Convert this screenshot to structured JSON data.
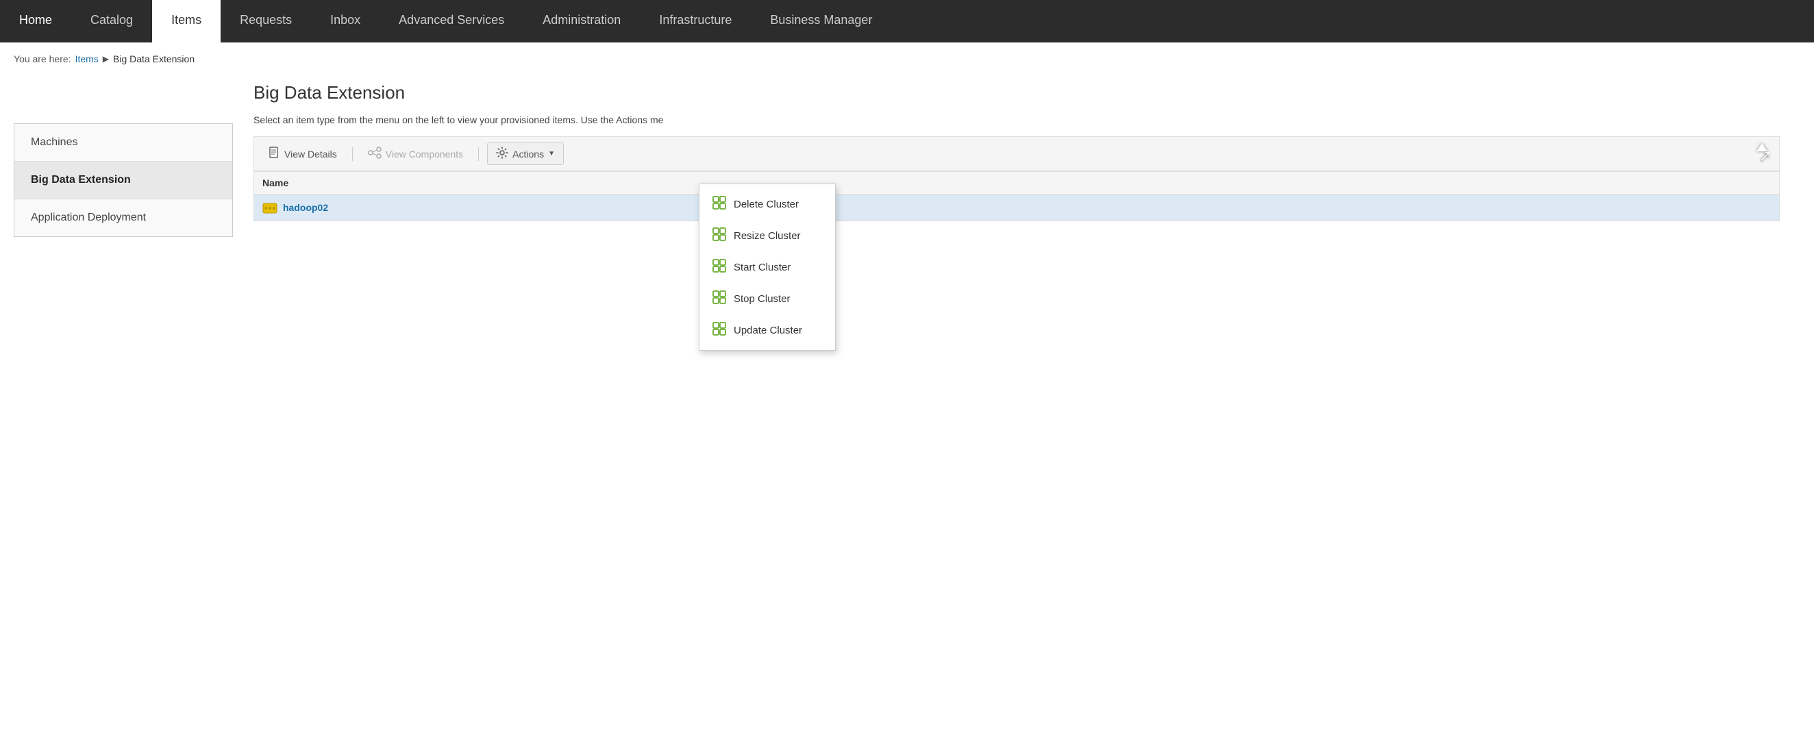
{
  "nav": {
    "items": [
      {
        "label": "Home",
        "active": false
      },
      {
        "label": "Catalog",
        "active": false
      },
      {
        "label": "Items",
        "active": true
      },
      {
        "label": "Requests",
        "active": false
      },
      {
        "label": "Inbox",
        "active": false
      },
      {
        "label": "Advanced Services",
        "active": false
      },
      {
        "label": "Administration",
        "active": false
      },
      {
        "label": "Infrastructure",
        "active": false
      },
      {
        "label": "Business Manager",
        "active": false
      }
    ]
  },
  "breadcrumb": {
    "prefix": "You are here:",
    "link": "Items",
    "separator": "▶",
    "current": "Big Data Extension"
  },
  "page": {
    "title": "Big Data Extension",
    "description": "Select an item type from the menu on the left to view your provisioned items. Use the Actions me"
  },
  "sidebar": {
    "items": [
      {
        "label": "Machines",
        "active": false
      },
      {
        "label": "Big Data Extension",
        "active": true
      },
      {
        "label": "Application Deployment",
        "active": false
      }
    ]
  },
  "toolbar": {
    "view_details": "View Details",
    "view_components": "View Components",
    "actions": "Actions"
  },
  "table": {
    "columns": [
      "Name"
    ],
    "rows": [
      {
        "name": "hadoop02",
        "selected": true
      }
    ]
  },
  "dropdown": {
    "items": [
      "Delete Cluster",
      "Resize Cluster",
      "Start Cluster",
      "Stop Cluster",
      "Update Cluster"
    ]
  }
}
